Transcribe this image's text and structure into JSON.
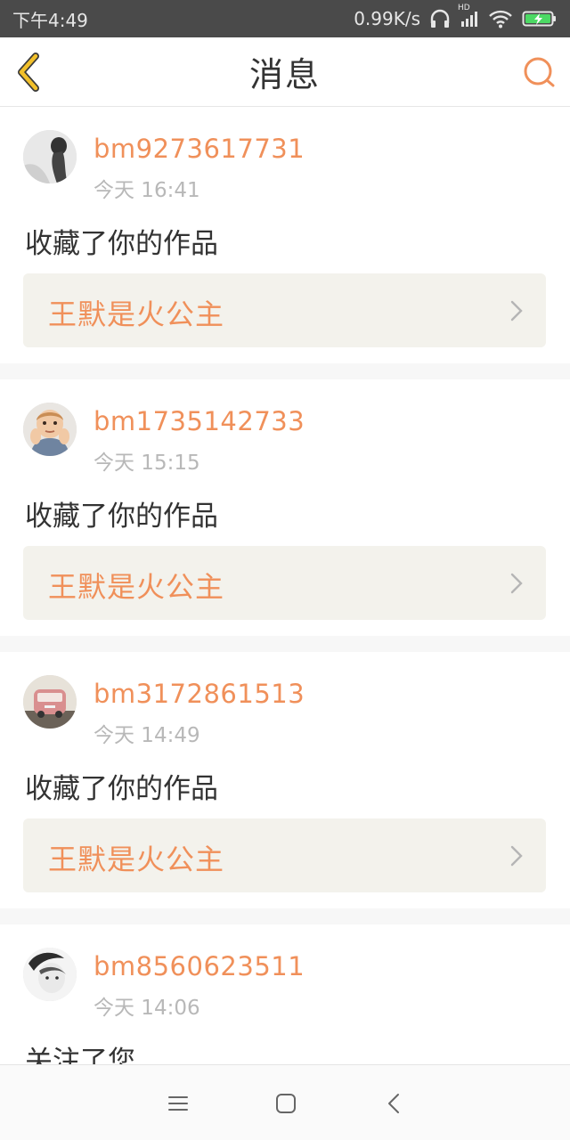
{
  "status_bar": {
    "time": "下午4:49",
    "net_speed": "0.99K/s",
    "network_label": "HD",
    "icons": [
      "headset-icon",
      "signal-icon",
      "wifi-icon",
      "battery-charging-icon"
    ]
  },
  "header": {
    "title": "消息",
    "back_icon": "chevron-left-icon",
    "search_icon": "search-icon"
  },
  "colors": {
    "accent": "#f0905a",
    "back_icon": "#e8b020",
    "work_bg": "#f3f2ec"
  },
  "messages": [
    {
      "username": "bm9273617731",
      "time": "今天 16:41",
      "action": "收藏了你的作品",
      "work_title": "王默是火公主"
    },
    {
      "username": "bm1735142733",
      "time": "今天 15:15",
      "action": "收藏了你的作品",
      "work_title": "王默是火公主"
    },
    {
      "username": "bm3172861513",
      "time": "今天 14:49",
      "action": "收藏了你的作品",
      "work_title": "王默是火公主"
    },
    {
      "username": "bm8560623511",
      "time": "今天 14:06",
      "action": "关注了您"
    }
  ],
  "nav_bar": {
    "icons": [
      "menu-icon",
      "home-square-icon",
      "back-chevron-icon"
    ]
  }
}
